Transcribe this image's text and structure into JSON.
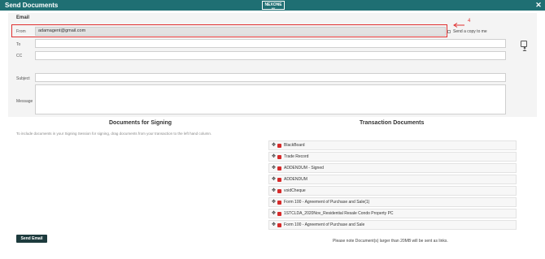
{
  "header": {
    "title": "Send Documents",
    "logo_text": "NEXONE",
    "logo_sub": "ver",
    "close_label": "✕"
  },
  "email_section": {
    "label": "Email"
  },
  "fields": {
    "from_label": "From",
    "from_value": "adamagent@gmail.com",
    "to_label": "To",
    "cc_label": "CC",
    "subject_label": "Subject",
    "message_label": "Message",
    "send_copy_label": "Send a copy to me"
  },
  "annotation": {
    "number": "4",
    "color": "#e03030"
  },
  "signing": {
    "title": "Documents for Signing",
    "hint": "To include documents in your Signing Session for signing, drag documents from your transaction to the left hand column."
  },
  "transaction": {
    "title": "Transaction Documents",
    "documents": [
      "BlackBoard",
      "Trade Record",
      "ADDENDUM - Signed",
      "ADDENDUM",
      "voidCheque",
      "Form 100 - Agreement of Purchase and Sale(1)",
      "1STCLDA_2020Nov_Residential Resale Condo Property PC",
      "Form 100 - Agreement of Purchase and Sale"
    ]
  },
  "footer": {
    "send_label": "Send Email",
    "note": "Please note Document(s) larger than 20MB will be sent as links."
  },
  "colors": {
    "header": "#1f6f73",
    "send_button": "#1d3b3d",
    "pdf_icon": "#d62b2b"
  }
}
